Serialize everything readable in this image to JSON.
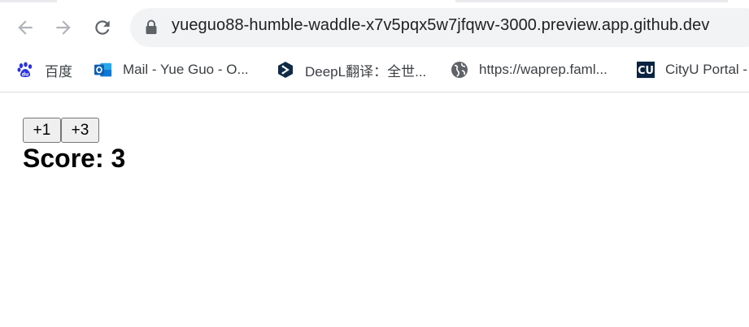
{
  "browser": {
    "url": "yueguo88-humble-waddle-x7v5pqx5w7jfqwv-3000.preview.app.github.dev",
    "bookmarks": [
      {
        "label": "百度",
        "icon": "baidu-paw-icon"
      },
      {
        "label": "Mail - Yue Guo - O...",
        "icon": "outlook-icon"
      },
      {
        "label": "DeepL翻译：全世...",
        "icon": "deepl-icon"
      },
      {
        "label": "https://waprep.faml...",
        "icon": "globe-icon"
      },
      {
        "label": "CityU Portal -",
        "icon": "cityu-icon"
      }
    ],
    "colors": {
      "omnibox_bg": "#f1f3f4",
      "baidu_blue": "#2932e1",
      "outlook_blue": "#0f78d4",
      "deepl_navy": "#0f2b46",
      "cityu_navy": "#0b2341"
    }
  },
  "app": {
    "buttons": [
      {
        "label": "+1"
      },
      {
        "label": "+3"
      }
    ],
    "score_label": "Score: 3"
  }
}
